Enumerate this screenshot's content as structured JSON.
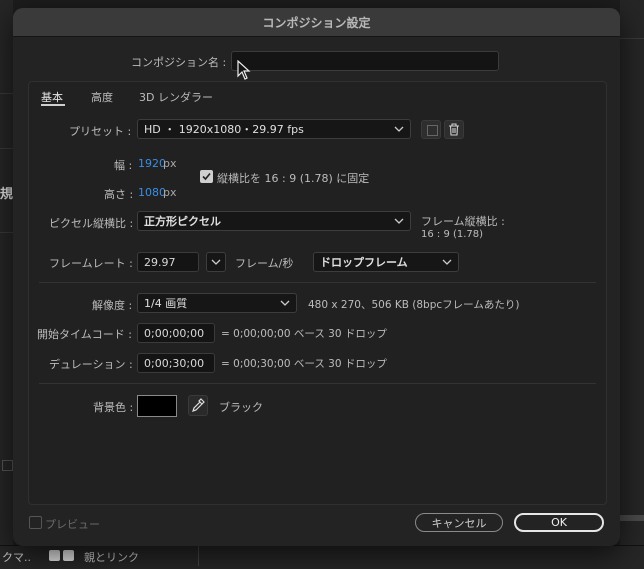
{
  "background": {
    "left_label": "規",
    "bottom_left_text": "クマ..",
    "bottom_parent_link": "親とリンク"
  },
  "dialog": {
    "title": "コンポジション設定",
    "comp_name": {
      "label": "コンポジション名 :",
      "value": ""
    },
    "tabs": [
      {
        "label": "基本",
        "active": true
      },
      {
        "label": "高度",
        "active": false
      },
      {
        "label": "3D レンダラー",
        "active": false
      }
    ],
    "preset": {
      "label": "プリセット :",
      "value": "HD ・ 1920x1080・29.97 fps"
    },
    "width": {
      "label": "幅 :",
      "value": "1920",
      "unit": "px"
    },
    "height": {
      "label": "高さ :",
      "value": "1080",
      "unit": "px"
    },
    "lock_aspect": {
      "checked": true,
      "label": "縦横比を 16 : 9 (1.78) に固定"
    },
    "pixel_aspect": {
      "label": "ピクセル縦横比 :",
      "value": "正方形ピクセル"
    },
    "frame_aspect": {
      "label": "フレーム縦横比 :",
      "value": "16 : 9 (1.78)"
    },
    "frame_rate": {
      "label": "フレームレート :",
      "value": "29.97",
      "unit": "フレーム/秒",
      "drop": "ドロップフレーム"
    },
    "resolution": {
      "label": "解像度 :",
      "value": "1/4 画質",
      "info": "480 x 270、506 KB (8bpcフレームあたり)"
    },
    "start_timecode": {
      "label": "開始タイムコード :",
      "value": "0;00;00;00",
      "info": "= 0;00;00;00  ベース 30   ドロップ"
    },
    "duration": {
      "label": "デュレーション :",
      "value": "0;00;30;00",
      "info": "= 0;00;30;00  ベース 30   ドロップ"
    },
    "bg_color": {
      "label": "背景色 :",
      "name": "ブラック",
      "swatch": "#000000"
    },
    "preview": {
      "label": "プレビュー",
      "checked": false
    },
    "buttons": {
      "cancel": "キャンセル",
      "ok": "OK"
    }
  },
  "colors": {
    "accent": "#3b8ee5",
    "dialog_bg": "#232323",
    "titlebar": "#3a3a3a"
  }
}
